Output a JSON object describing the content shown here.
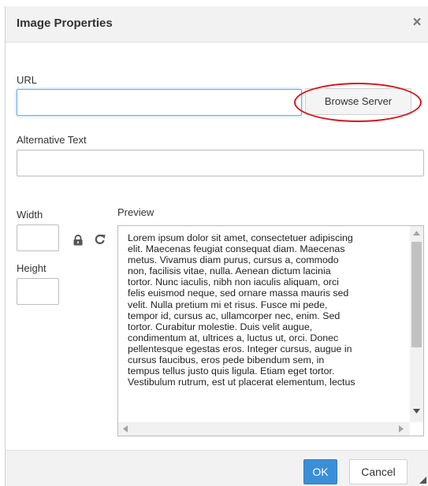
{
  "dialog": {
    "title": "Image Properties",
    "close_glyph": "×"
  },
  "url": {
    "label": "URL",
    "value": "",
    "placeholder": ""
  },
  "browse_button_label": "Browse Server",
  "alt_text": {
    "label": "Alternative Text",
    "value": ""
  },
  "width": {
    "label": "Width",
    "value": ""
  },
  "height": {
    "label": "Height",
    "value": ""
  },
  "icons": {
    "lock": "lock-icon",
    "reset": "reset-size-icon"
  },
  "preview": {
    "label": "Preview",
    "lines": [
      "Lorem ipsum dolor sit amet, consectetuer adipiscing",
      "elit. Maecenas feugiat consequat diam. Maecenas",
      "metus. Vivamus diam purus, cursus a, commodo",
      "non, facilisis vitae, nulla. Aenean dictum lacinia",
      "tortor. Nunc iaculis, nibh non iaculis aliquam, orci",
      "felis euismod neque, sed ornare massa mauris sed",
      "velit. Nulla pretium mi et risus. Fusce mi pede,",
      "tempor id, cursus ac, ullamcorper nec, enim. Sed",
      "tortor. Curabitur molestie. Duis velit augue,",
      "condimentum at, ultrices a, luctus ut, orci. Donec",
      "pellentesque egestas eros. Integer cursus, augue in",
      "cursus faucibus, eros pede bibendum sem, in",
      "tempus tellus justo quis ligula. Etiam eget tortor.",
      "Vestibulum rutrum, est ut placerat elementum, lectus"
    ]
  },
  "footer": {
    "ok_label": "OK",
    "cancel_label": "Cancel"
  },
  "colors": {
    "ok_button": "#3a8fd8",
    "annotation_circle": "#d9151a",
    "focus_border": "#66afe9"
  }
}
